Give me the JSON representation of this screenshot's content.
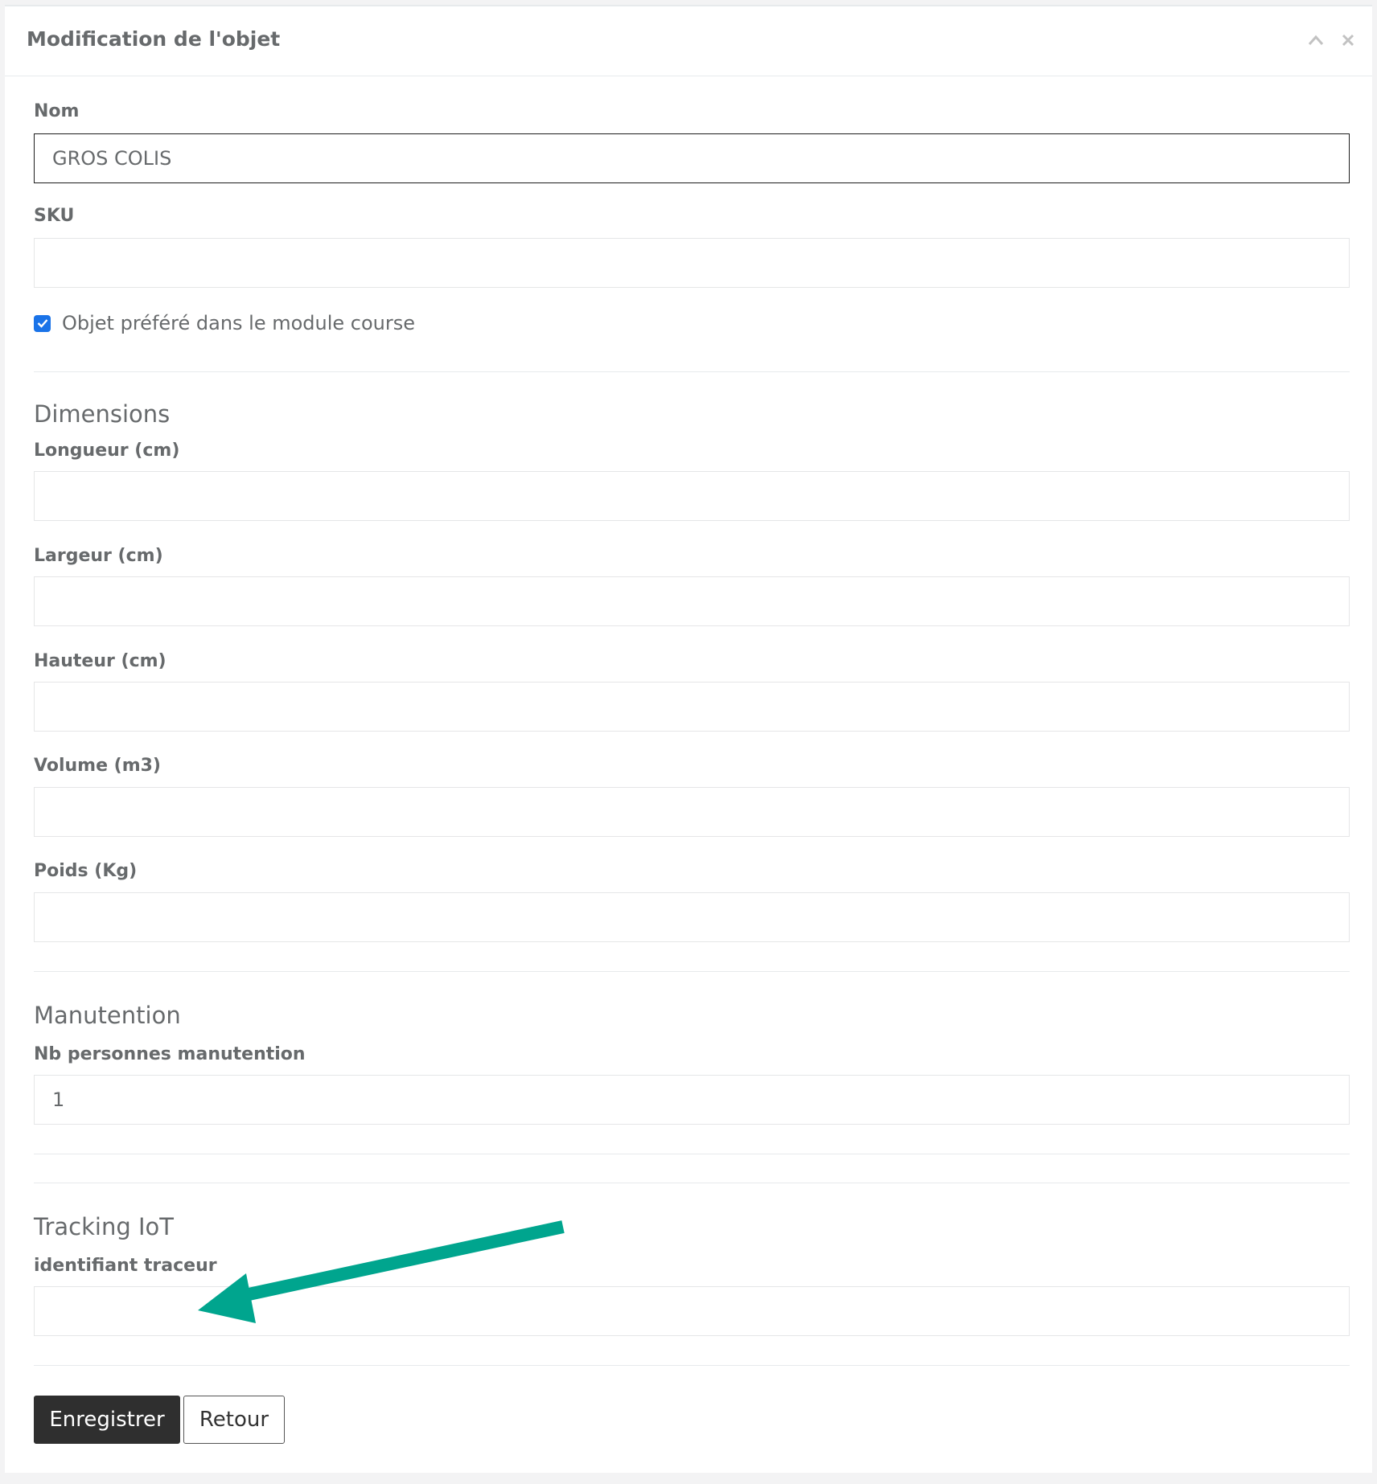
{
  "panel": {
    "title": "Modification de l'objet",
    "tools": [
      "chevron-up-icon",
      "close-icon"
    ]
  },
  "form": {
    "nom": {
      "label": "Nom",
      "value": "GROS COLIS"
    },
    "sku": {
      "label": "SKU",
      "value": ""
    },
    "favorite": {
      "label": "Objet préféré dans le module course",
      "checked": true
    },
    "dimensions": {
      "title": "Dimensions",
      "longueur": {
        "label": "Longueur (cm)",
        "value": ""
      },
      "largeur": {
        "label": "Largeur (cm)",
        "value": ""
      },
      "hauteur": {
        "label": "Hauteur (cm)",
        "value": ""
      },
      "volume": {
        "label": "Volume (m3)",
        "value": ""
      },
      "poids": {
        "label": "Poids (Kg)",
        "value": ""
      }
    },
    "manutention": {
      "title": "Manutention",
      "nb_personnes": {
        "label": "Nb personnes manutention",
        "value": "1"
      }
    },
    "tracking": {
      "title": "Tracking IoT",
      "identifiant": {
        "label": "identifiant traceur",
        "value": ""
      }
    }
  },
  "buttons": {
    "save": "Enregistrer",
    "back": "Retour"
  },
  "colors": {
    "arrow": "#00a58e",
    "primary_button": "#2f2f2f",
    "checkbox": "#1a73e8"
  }
}
